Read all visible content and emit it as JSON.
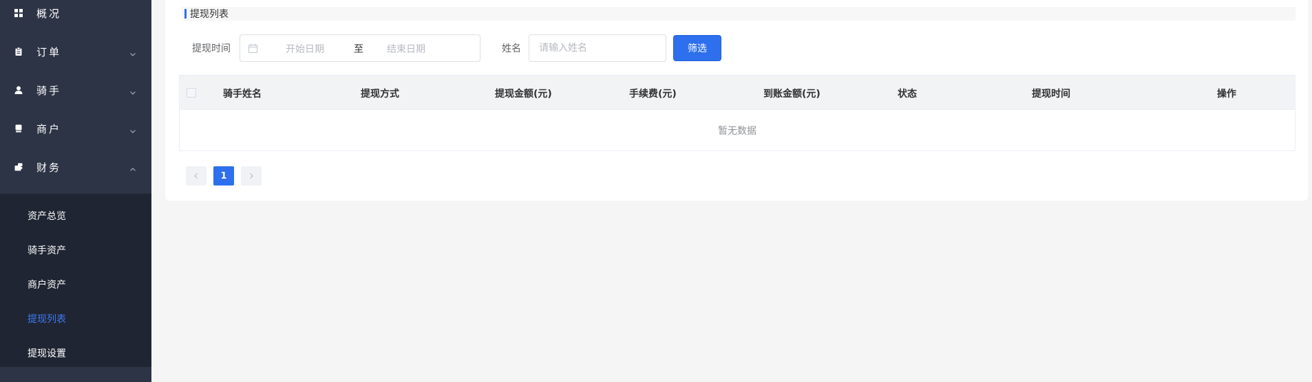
{
  "sidebar": {
    "menu": [
      {
        "label": "概况",
        "icon": "dashboard-icon",
        "has_arrow": false
      },
      {
        "label": "订单",
        "icon": "clipboard-icon",
        "has_arrow": true,
        "expanded": false
      },
      {
        "label": "骑手",
        "icon": "user-icon",
        "has_arrow": true,
        "expanded": false
      },
      {
        "label": "商户",
        "icon": "shop-icon",
        "has_arrow": true,
        "expanded": false
      },
      {
        "label": "财务",
        "icon": "wallet-icon",
        "has_arrow": true,
        "expanded": true
      }
    ],
    "finance_submenu": [
      {
        "label": "资产总览",
        "active": false
      },
      {
        "label": "骑手资产",
        "active": false
      },
      {
        "label": "商户资产",
        "active": false
      },
      {
        "label": "提现列表",
        "active": true
      },
      {
        "label": "提现设置",
        "active": false
      }
    ]
  },
  "page": {
    "section_title": "提现列表"
  },
  "filters": {
    "time_label": "提现时间",
    "start_placeholder": "开始日期",
    "range_separator": "至",
    "end_placeholder": "结束日期",
    "name_label": "姓名",
    "name_placeholder": "请输入姓名",
    "name_value": "",
    "submit_label": "筛选"
  },
  "table": {
    "columns": [
      "骑手姓名",
      "提现方式",
      "提现金额(元)",
      "手续费(元)",
      "到账金额(元)",
      "状态",
      "提现时间",
      "操作"
    ],
    "rows": [],
    "empty_text": "暂无数据"
  },
  "pagination": {
    "current_page": "1"
  },
  "colors": {
    "sidebar_bg": "#2d3446",
    "submenu_bg": "#1f2532",
    "accent": "#2d6fed",
    "active_text": "#3f7af0"
  }
}
